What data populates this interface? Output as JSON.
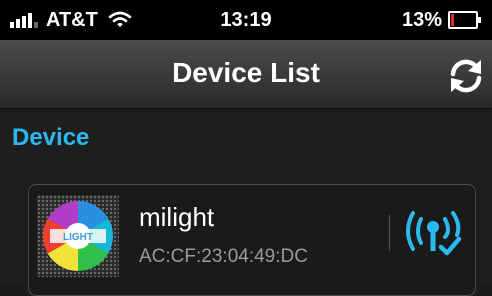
{
  "status_bar": {
    "carrier": "AT&T",
    "time": "13:19",
    "battery_percent": "13%",
    "battery_level": 0.13,
    "battery_color": "#e0291f",
    "signal_bars": 4,
    "icons": [
      "signal-icon",
      "wifi-icon",
      "battery-icon"
    ]
  },
  "nav": {
    "title": "Device List",
    "refresh_icon": "refresh-icon"
  },
  "section": {
    "header": "Device",
    "header_color": "#2bb9ee"
  },
  "devices": [
    {
      "name": "milight",
      "mac": "AC:CF:23:04:49:DC",
      "thumb_text": "LIGHT",
      "status_icon": "wifi-connected-icon",
      "status_color": "#2bb9ee"
    }
  ]
}
